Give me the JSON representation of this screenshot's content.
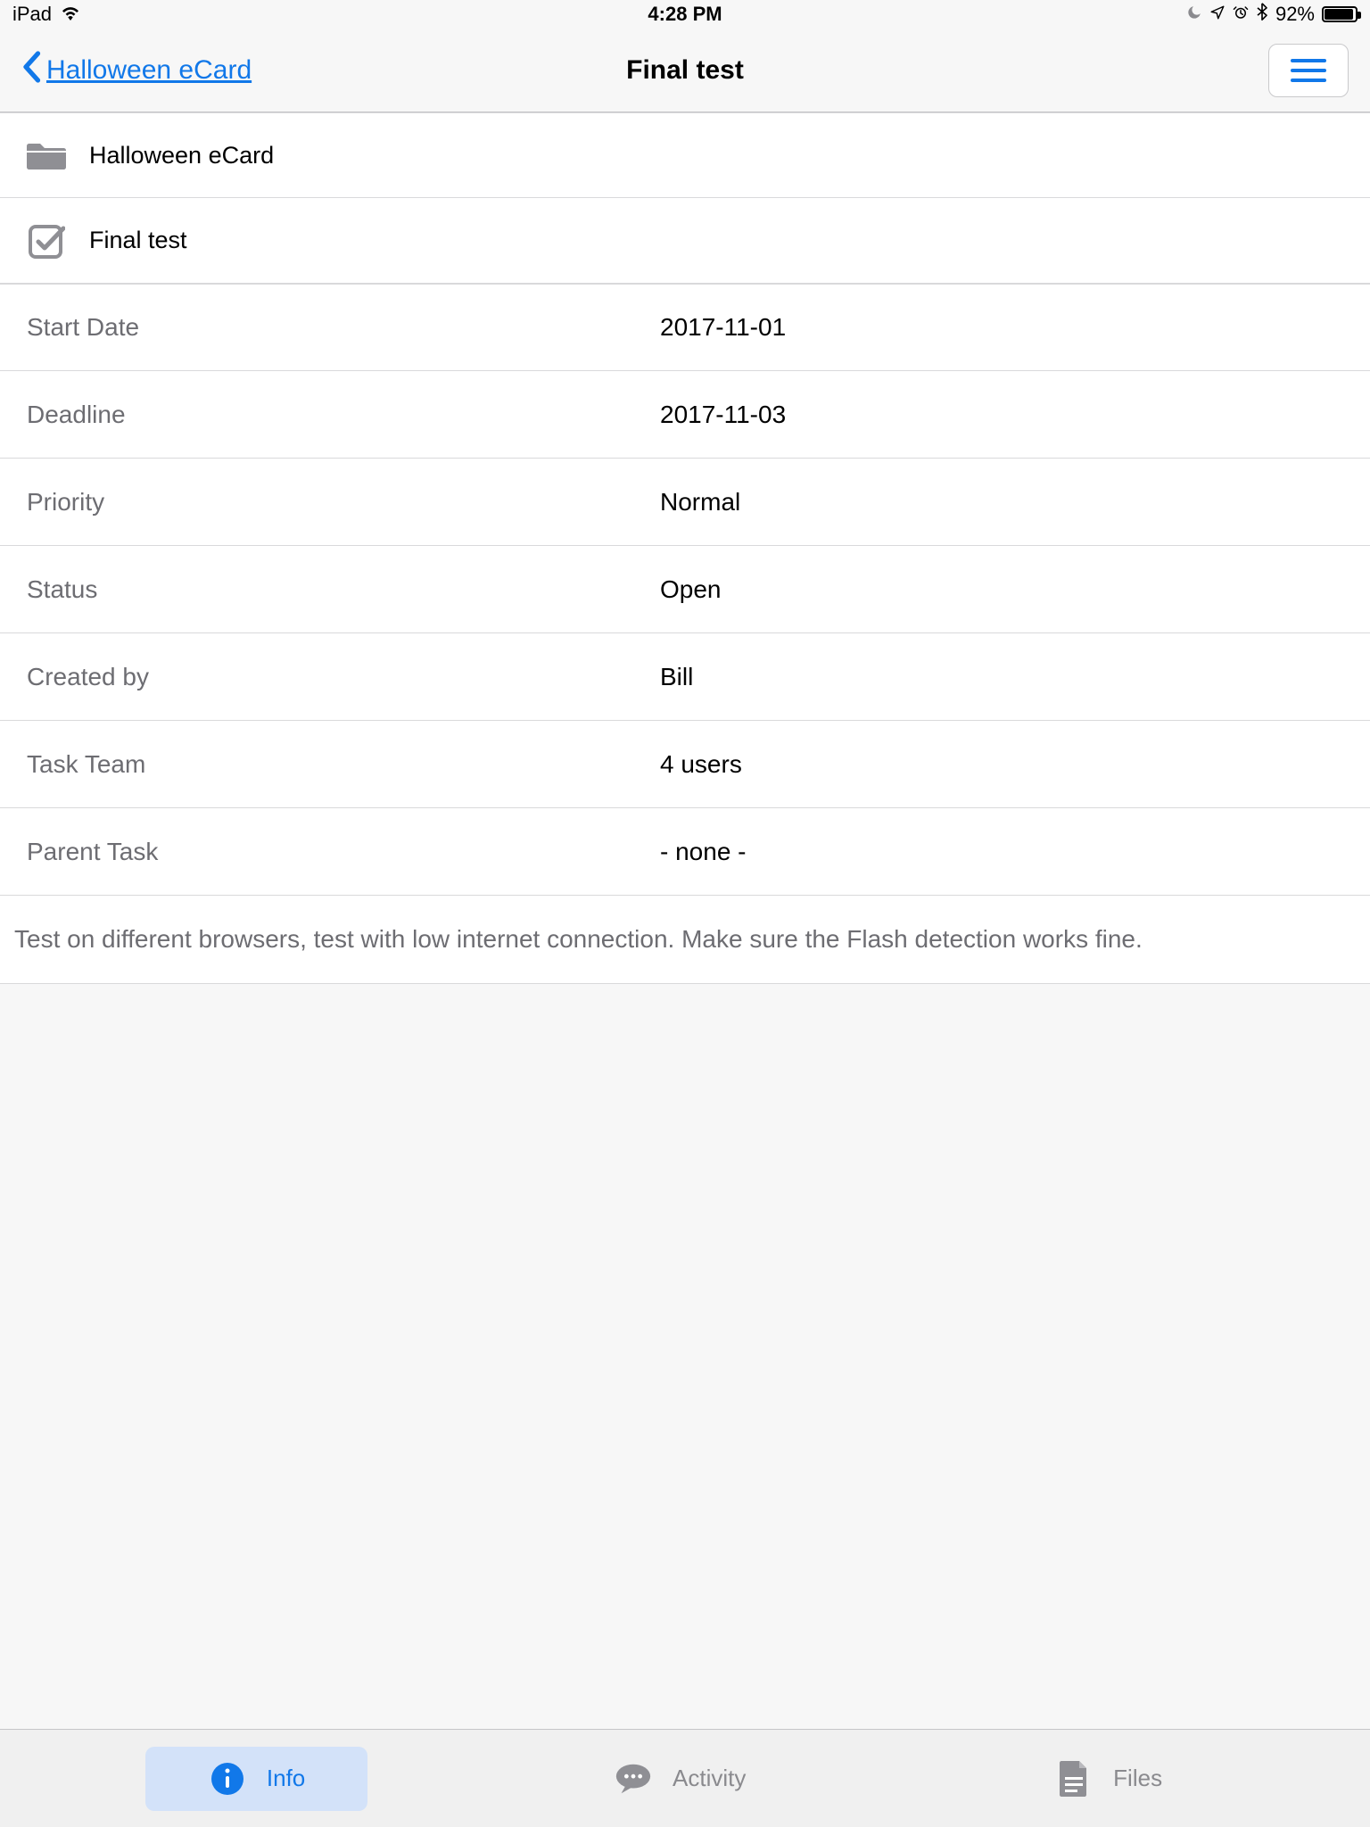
{
  "status_bar": {
    "device": "iPad",
    "time": "4:28 PM",
    "battery_pct": "92%"
  },
  "nav": {
    "back_label": "Halloween eCard",
    "title": "Final test"
  },
  "breadcrumb": {
    "project": "Halloween eCard",
    "task": "Final test"
  },
  "fields": {
    "start_date": {
      "label": "Start Date",
      "value": "2017-11-01"
    },
    "deadline": {
      "label": "Deadline",
      "value": "2017-11-03"
    },
    "priority": {
      "label": "Priority",
      "value": "Normal"
    },
    "status": {
      "label": "Status",
      "value": "Open"
    },
    "created_by": {
      "label": "Created by",
      "value": "Bill"
    },
    "task_team": {
      "label": "Task Team",
      "value": "4 users"
    },
    "parent_task": {
      "label": "Parent Task",
      "value": "- none -"
    }
  },
  "description": "Test on different browsers, test with low internet connection. Make sure the Flash detection works fine.",
  "tabs": {
    "info": "Info",
    "activity": "Activity",
    "files": "Files"
  }
}
